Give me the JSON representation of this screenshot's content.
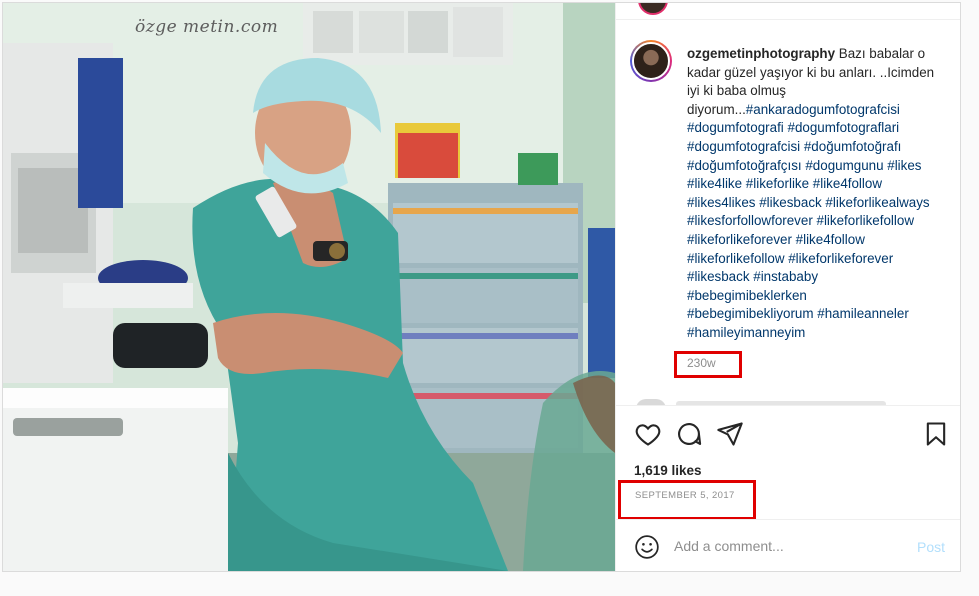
{
  "photo": {
    "watermark": "özge metin.com",
    "alt_subject": "surgeon-in-scrubs"
  },
  "post": {
    "username": "ozgemetinphotography",
    "caption_lines": [
      {
        "text": " Bazı babalar o",
        "type": "plain"
      },
      {
        "text": "kadar güzel yaşıyor ki bu anları. ..Icimden",
        "type": "plain"
      },
      {
        "text": "iyi ki baba olmuş",
        "type": "plain"
      },
      {
        "text": "diyorum...",
        "type": "plain",
        "tag_after": "#ankaradogumfotografcisi"
      },
      {
        "text": "#dogumfotografi #dogumfotograflari",
        "type": "tag"
      },
      {
        "text": "#dogumfotografcisi #doğumfotoğrafı",
        "type": "tag"
      },
      {
        "text": "#doğumfotoğrafçısı #dogumgunu #likes",
        "type": "tag"
      },
      {
        "text": "#like4like #likeforlike #like4follow",
        "type": "tag"
      },
      {
        "text": "#likes4likes #likesback #likeforlikealways",
        "type": "tag"
      },
      {
        "text": "#likesforfollowforever #likeforlikefollow",
        "type": "tag"
      },
      {
        "text": "#likeforlikeforever #like4follow",
        "type": "tag"
      },
      {
        "text": "#likeforlikefollow #likeforlikeforever",
        "type": "tag"
      },
      {
        "text": "#likesback #instababy",
        "type": "tag"
      },
      {
        "text": "#bebegimibeklerken",
        "type": "tag"
      },
      {
        "text": "#bebegimibekliyorum #hamileanneler",
        "type": "tag"
      },
      {
        "text": "#hamileyimanneyim",
        "type": "tag"
      }
    ],
    "time_ago": "230w",
    "likes": "1,619 likes",
    "date": "SEPTEMBER 5, 2017"
  },
  "actions": {
    "like_icon": "heart-icon",
    "comment_icon": "comment-bubble-icon",
    "share_icon": "paper-plane-icon",
    "save_icon": "bookmark-icon"
  },
  "comment_box": {
    "placeholder": "Add a comment...",
    "post_label": "Post",
    "post_color": "#b2dffc"
  },
  "colors": {
    "tag": "#00376b",
    "highlight_box": "#e00000",
    "muted": "#8e8e8e"
  }
}
